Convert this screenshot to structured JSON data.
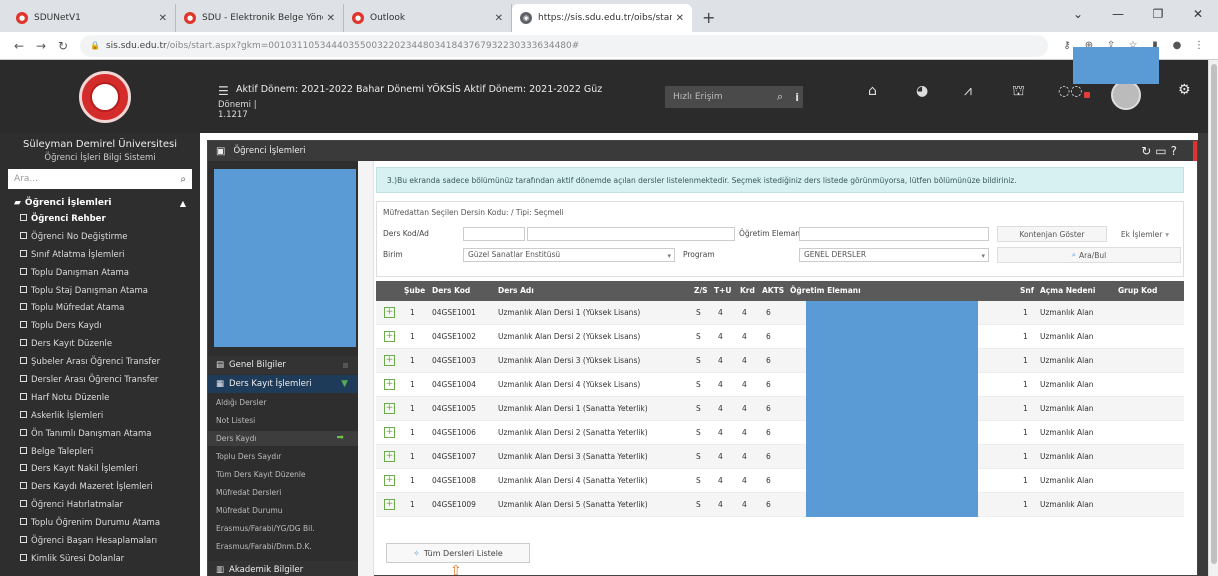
{
  "browser": {
    "tabs": [
      {
        "label": "SDUNetV1",
        "icon": "sdu-icon",
        "active": false
      },
      {
        "label": "SDÜ - Elektronik Belge Yönetim Si",
        "icon": "sdu-icon",
        "active": false
      },
      {
        "label": "Outlook",
        "icon": "sdu-icon",
        "active": false
      },
      {
        "label": "https://sis.sdu.edu.tr/oibs/start.a",
        "icon": "globe-icon",
        "active": true
      }
    ],
    "new_tab": "+",
    "url_host": "sis.sdu.edu.tr",
    "url_path": "/oibs/start.aspx?gkm=00103110534440355003220234480341843767932230333634480#"
  },
  "header": {
    "title": "Aktif Dönem: 2021-2022 Bahar Dönemi YÖKSİS Aktif Dönem: 2021-2022 Güz",
    "subtitle_line1": "Dönemi  |",
    "subtitle_line2": "1.1217",
    "search_placeholder": "Hızlı Erişim"
  },
  "sidebar": {
    "university": "Süleyman Demirel Üniversitesi",
    "system": "Öğrenci İşleri Bilgi Sistemi",
    "search_placeholder": "Ara...",
    "group_label": "Öğrenci İşlemleri",
    "items": [
      "Öğrenci Rehber",
      "Öğrenci No Değiştirme",
      "Sınıf Atlatma İşlemleri",
      "Toplu Danışman Atama",
      "Toplu Staj Danışman Atama",
      "Toplu Müfredat Atama",
      "Toplu Ders Kaydı",
      "Ders Kayıt Düzenle",
      "Şubeler Arası Öğrenci Transfer",
      "Dersler Arası Öğrenci Transfer",
      "Harf Notu Düzenle",
      "Askerlik İşlemleri",
      "Ön Tanımlı Danışman Atama",
      "Belge Talepleri",
      "Ders Kayıt Nakil İşlemleri",
      "Ders Kaydı Mazeret İşlemleri",
      "Öğrenci Hatırlatmalar",
      "Toplu Öğrenim Durumu Atama",
      "Öğrenci Başarı Hesaplamaları",
      "Kimlik Süresi Dolanlar"
    ]
  },
  "module": {
    "title": "Öğrenci İşlemleri",
    "inner_menu": {
      "genel": "Genel Bilgiler",
      "ders_kayit": "Ders Kayıt İşlemleri",
      "items": [
        "Aldığı Dersler",
        "Not Listesi",
        "Ders Kaydı",
        "Toplu Ders Saydır",
        "Tüm Ders Kayıt Düzenle",
        "Müfredat Dersleri",
        "Müfredat Durumu",
        "Erasmus/Farabi/YG/DG Bil.",
        "Erasmus/Farabi/Dnm.D.K."
      ],
      "akademik": "Akademik Bilgiler"
    },
    "note": "3.)Bu ekranda sadece bölümünüz tarafından aktif dönemde açılan dersler listelenmektedir. Seçmek istediğiniz ders listede görünmüyorsa, lütfen bölümünüze bildiriniz.",
    "filter": {
      "title": "Müfredattan Seçilen Dersin Kodu: / Tipi: Seçmeli",
      "ders_kod_label": "Ders Kod/Ad",
      "ogretim_label": "Öğretim Elemanı",
      "kontenjan_button": "Kontenjan Göster",
      "ek_islemler": "Ek İşlemler",
      "birim_label": "Birim",
      "birim_value": "Güzel Sanatlar Enstitüsü",
      "program_label": "Program",
      "program_value": "GENEL DERSLER",
      "ara_button": "Ara/Bul"
    },
    "columns": {
      "sube": "Şube",
      "ders_kod": "Ders Kod",
      "ders_adi": "Ders Adı",
      "zs": "Z/S",
      "tu": "T+U",
      "krd": "Krd",
      "akts": "AKTS",
      "ogretim": "Öğretim Elemanı",
      "snf": "Snf",
      "acma": "Açma Nedeni",
      "grup": "Grup Kod"
    },
    "rows": [
      {
        "sube": "1",
        "kod": "04GSE1001",
        "ad": "Uzmanlık Alan Dersi 1 (Yüksek Lisans)",
        "zs": "S",
        "tu": "4",
        "krd": "4",
        "akts": "6",
        "snf": "1",
        "acma": "Uzmanlık Alan"
      },
      {
        "sube": "1",
        "kod": "04GSE1002",
        "ad": "Uzmanlık Alan Dersi 2 (Yüksek Lisans)",
        "zs": "S",
        "tu": "4",
        "krd": "4",
        "akts": "6",
        "snf": "1",
        "acma": "Uzmanlık Alan"
      },
      {
        "sube": "1",
        "kod": "04GSE1003",
        "ad": "Uzmanlık Alan Dersi 3 (Yüksek Lisans)",
        "zs": "S",
        "tu": "4",
        "krd": "4",
        "akts": "6",
        "snf": "1",
        "acma": "Uzmanlık Alan"
      },
      {
        "sube": "1",
        "kod": "04GSE1004",
        "ad": "Uzmanlık Alan Dersi 4 (Yüksek Lisans)",
        "zs": "S",
        "tu": "4",
        "krd": "4",
        "akts": "6",
        "snf": "1",
        "acma": "Uzmanlık Alan"
      },
      {
        "sube": "1",
        "kod": "04GSE1005",
        "ad": "Uzmanlık Alan Dersi 1 (Sanatta Yeterlik)",
        "zs": "S",
        "tu": "4",
        "krd": "4",
        "akts": "6",
        "snf": "1",
        "acma": "Uzmanlık Alan"
      },
      {
        "sube": "1",
        "kod": "04GSE1006",
        "ad": "Uzmanlık Alan Dersi 2 (Sanatta Yeterlik)",
        "zs": "S",
        "tu": "4",
        "krd": "4",
        "akts": "6",
        "snf": "1",
        "acma": "Uzmanlık Alan"
      },
      {
        "sube": "1",
        "kod": "04GSE1007",
        "ad": "Uzmanlık Alan Dersi 3 (Sanatta Yeterlik)",
        "zs": "S",
        "tu": "4",
        "krd": "4",
        "akts": "6",
        "snf": "1",
        "acma": "Uzmanlık Alan"
      },
      {
        "sube": "1",
        "kod": "04GSE1008",
        "ad": "Uzmanlık Alan Dersi 4 (Sanatta Yeterlik)",
        "zs": "S",
        "tu": "4",
        "krd": "4",
        "akts": "6",
        "snf": "1",
        "acma": "Uzmanlık Alan"
      },
      {
        "sube": "1",
        "kod": "04GSE1009",
        "ad": "Uzmanlık Alan Dersi 5 (Sanatta Yeterlik)",
        "zs": "S",
        "tu": "4",
        "krd": "4",
        "akts": "6",
        "snf": "1",
        "acma": "Uzmanlık Alan"
      }
    ],
    "list_all_button": "Tüm Dersleri Listele"
  },
  "colors": {
    "dark": "#2b2b2b",
    "highlight_blue": "#5b9bd5",
    "note_bg": "#d7f0f2",
    "accent_orange": "#e87722",
    "green": "#6bab4a"
  }
}
